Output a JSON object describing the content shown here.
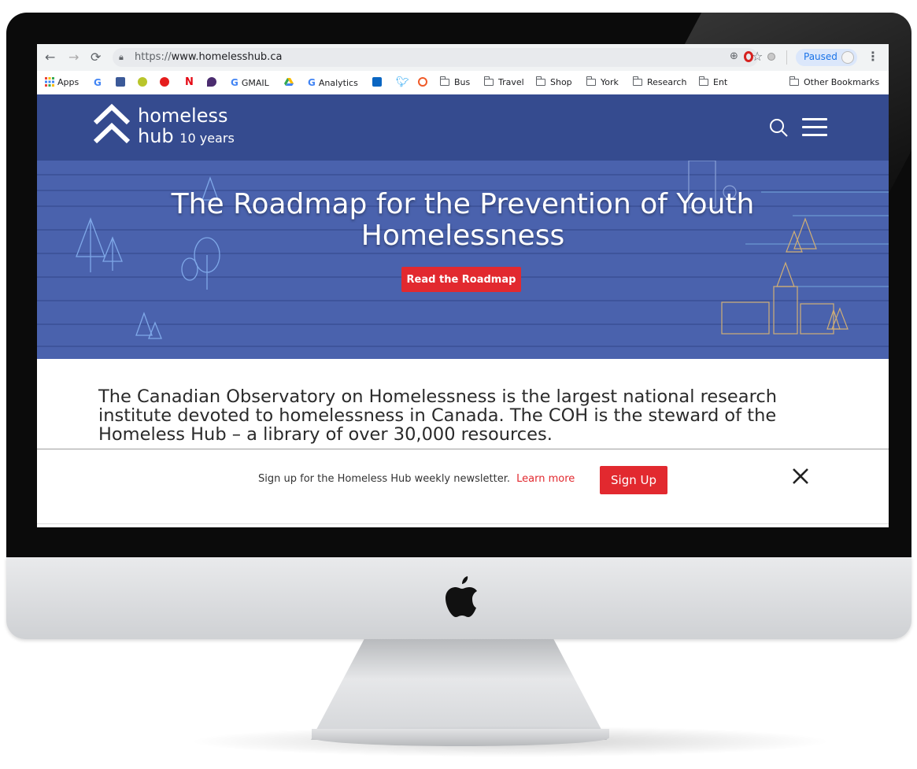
{
  "browser": {
    "url_scheme": "https://",
    "url_host": "www.homelesshub.ca",
    "profile_status": "Paused",
    "bookmarks": [
      {
        "label": "Apps",
        "icon": "apps-grid-icon"
      },
      {
        "label": "",
        "icon": "google-icon"
      },
      {
        "label": "",
        "icon": "facebook-icon"
      },
      {
        "label": "",
        "icon": "sphere-icon"
      },
      {
        "label": "",
        "icon": "cbc-icon"
      },
      {
        "label": "",
        "icon": "netflix-icon"
      },
      {
        "label": "",
        "icon": "drop-icon"
      },
      {
        "label": "GMAIL",
        "icon": "google-icon"
      },
      {
        "label": "",
        "icon": "drive-icon"
      },
      {
        "label": "Analytics",
        "icon": "google-icon"
      },
      {
        "label": "",
        "icon": "linkedin-icon"
      },
      {
        "label": "",
        "icon": "twitter-icon"
      },
      {
        "label": "",
        "icon": "hootsuite-icon"
      },
      {
        "label": "Bus",
        "icon": "folder-icon"
      },
      {
        "label": "Travel",
        "icon": "folder-icon"
      },
      {
        "label": "Shop",
        "icon": "folder-icon"
      },
      {
        "label": "York",
        "icon": "folder-icon"
      },
      {
        "label": "Research",
        "icon": "folder-icon"
      },
      {
        "label": "Ent",
        "icon": "folder-icon"
      },
      {
        "label": "Other Bookmarks",
        "icon": "folder-icon"
      }
    ]
  },
  "site": {
    "logo_line1": "homeless",
    "logo_line2": "hub",
    "logo_years": "10 years",
    "hero_title_line1": "The Roadmap for the Prevention of Youth",
    "hero_title_line2": "Homelessness",
    "hero_button": "Read the Roadmap",
    "intro_text": "The Canadian Observatory on Homelessness is the largest national research institute devoted to homelessness in Canada. The COH is the steward of the Homeless Hub – a library of over 30,000 resources.",
    "newsletter_text": "Sign up for the Homeless Hub weekly newsletter.",
    "newsletter_link": "Learn more",
    "newsletter_button": "Sign Up"
  },
  "colors": {
    "header": "#354b8f",
    "hero": "#4a62ad",
    "accent_red": "#e2292f"
  }
}
